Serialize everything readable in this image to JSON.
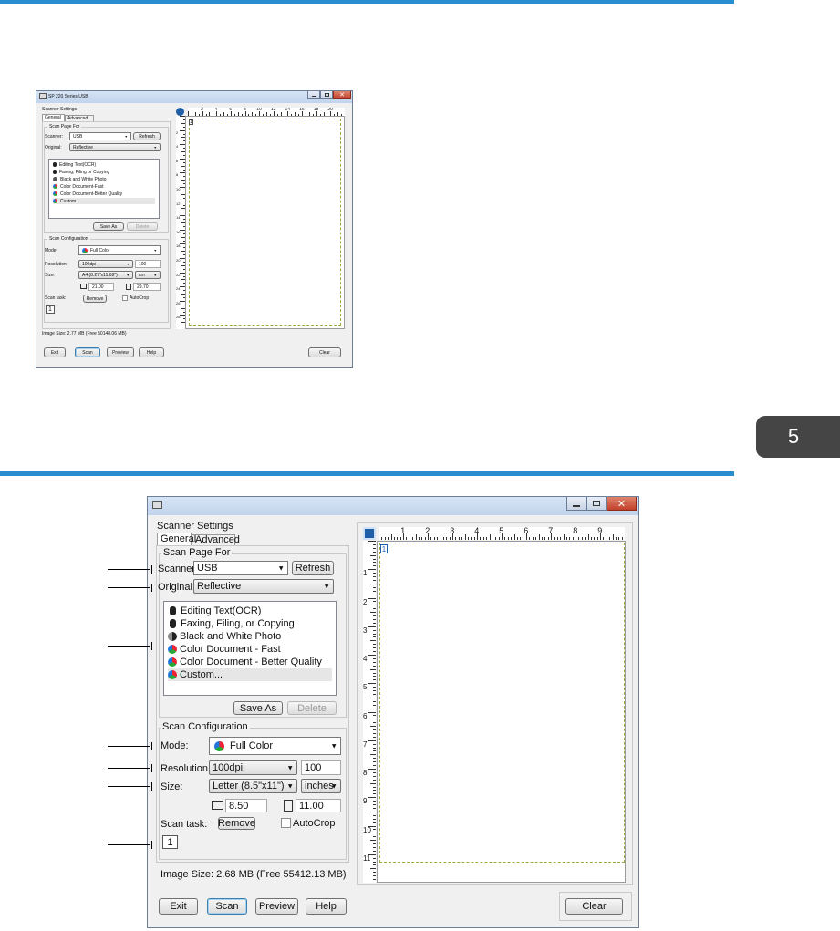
{
  "page": {
    "chapter_tab": "5",
    "accent_color": "#2a8dcf"
  },
  "small_window": {
    "title": "SP 220 Series USB",
    "menu_label": "Scanner Settings",
    "tabs": [
      "General",
      "Advanced"
    ],
    "scan_page_for": "Scan Page For",
    "scanner_label": "Scanner:",
    "scanner_value": "USB",
    "refresh": "Refresh",
    "original_label": "Original:",
    "original_value": "Reflective",
    "presets": [
      "Editing Text(OCR)",
      "Faxing, Filing or Copying",
      "Black and White Photo",
      "Color Document-Fast",
      "Color Document-Better Quality",
      "Custom..."
    ],
    "save_as": "Save As",
    "delete": "Delete",
    "scan_configuration": "Scan Configuration",
    "mode_label": "Mode:",
    "mode_value": "Full Color",
    "resolution_label": "Resolution:",
    "resolution_value": "100dpi",
    "resolution_number": "100",
    "size_label": "Size:",
    "size_value": "A4 (8.27\"x11.69\")",
    "unit_value": "cm",
    "width_value": "21.00",
    "height_value": "29.70",
    "scan_task_label": "Scan task:",
    "remove": "Remove",
    "autocrop": "AutoCrop",
    "task_number": "1",
    "image_size": "Image Size: 2.77 MB (Free 50148.06 MB)",
    "exit": "Exit",
    "scan": "Scan",
    "preview": "Preview",
    "help": "Help",
    "clear": "Clear",
    "ruler_top": [
      "2",
      "4",
      "6",
      "8",
      "10",
      "12",
      "14",
      "16",
      "18",
      "20"
    ],
    "ruler_left": [
      "2",
      "4",
      "6",
      "8",
      "10",
      "12",
      "14",
      "16",
      "18",
      "20",
      "22",
      "24",
      "26",
      "28"
    ]
  },
  "large_window": {
    "menu_label": "Scanner Settings",
    "tabs": [
      "General",
      "Advanced"
    ],
    "scan_page_for": "Scan Page For",
    "scanner_label": "Scanner:",
    "scanner_value": "USB",
    "refresh": "Refresh",
    "original_label": "Original:",
    "original_value": "Reflective",
    "presets": [
      "Editing Text(OCR)",
      "Faxing, Filing, or Copying",
      "Black and White Photo",
      "Color Document - Fast",
      "Color Document - Better Quality",
      "Custom..."
    ],
    "save_as": "Save As",
    "delete": "Delete",
    "scan_configuration": "Scan Configuration",
    "mode_label": "Mode:",
    "mode_value": "Full Color",
    "resolution_label": "Resolution:",
    "resolution_value": "100dpi",
    "resolution_number": "100",
    "size_label": "Size:",
    "size_value": "Letter (8.5\"x11\")",
    "unit_value": "inches",
    "width_value": "8.50",
    "height_value": "11.00",
    "scan_task_label": "Scan task:",
    "remove": "Remove",
    "autocrop": "AutoCrop",
    "task_number": "1",
    "image_size": "Image Size: 2.68 MB (Free 55412.13 MB)",
    "exit": "Exit",
    "scan": "Scan",
    "preview": "Preview",
    "help": "Help",
    "clear": "Clear",
    "ruler_top": [
      "1",
      "2",
      "3",
      "4",
      "5",
      "6",
      "7",
      "8",
      "9"
    ],
    "ruler_left": [
      "1",
      "2",
      "3",
      "4",
      "5",
      "6",
      "7",
      "8",
      "9",
      "10",
      "11"
    ]
  }
}
